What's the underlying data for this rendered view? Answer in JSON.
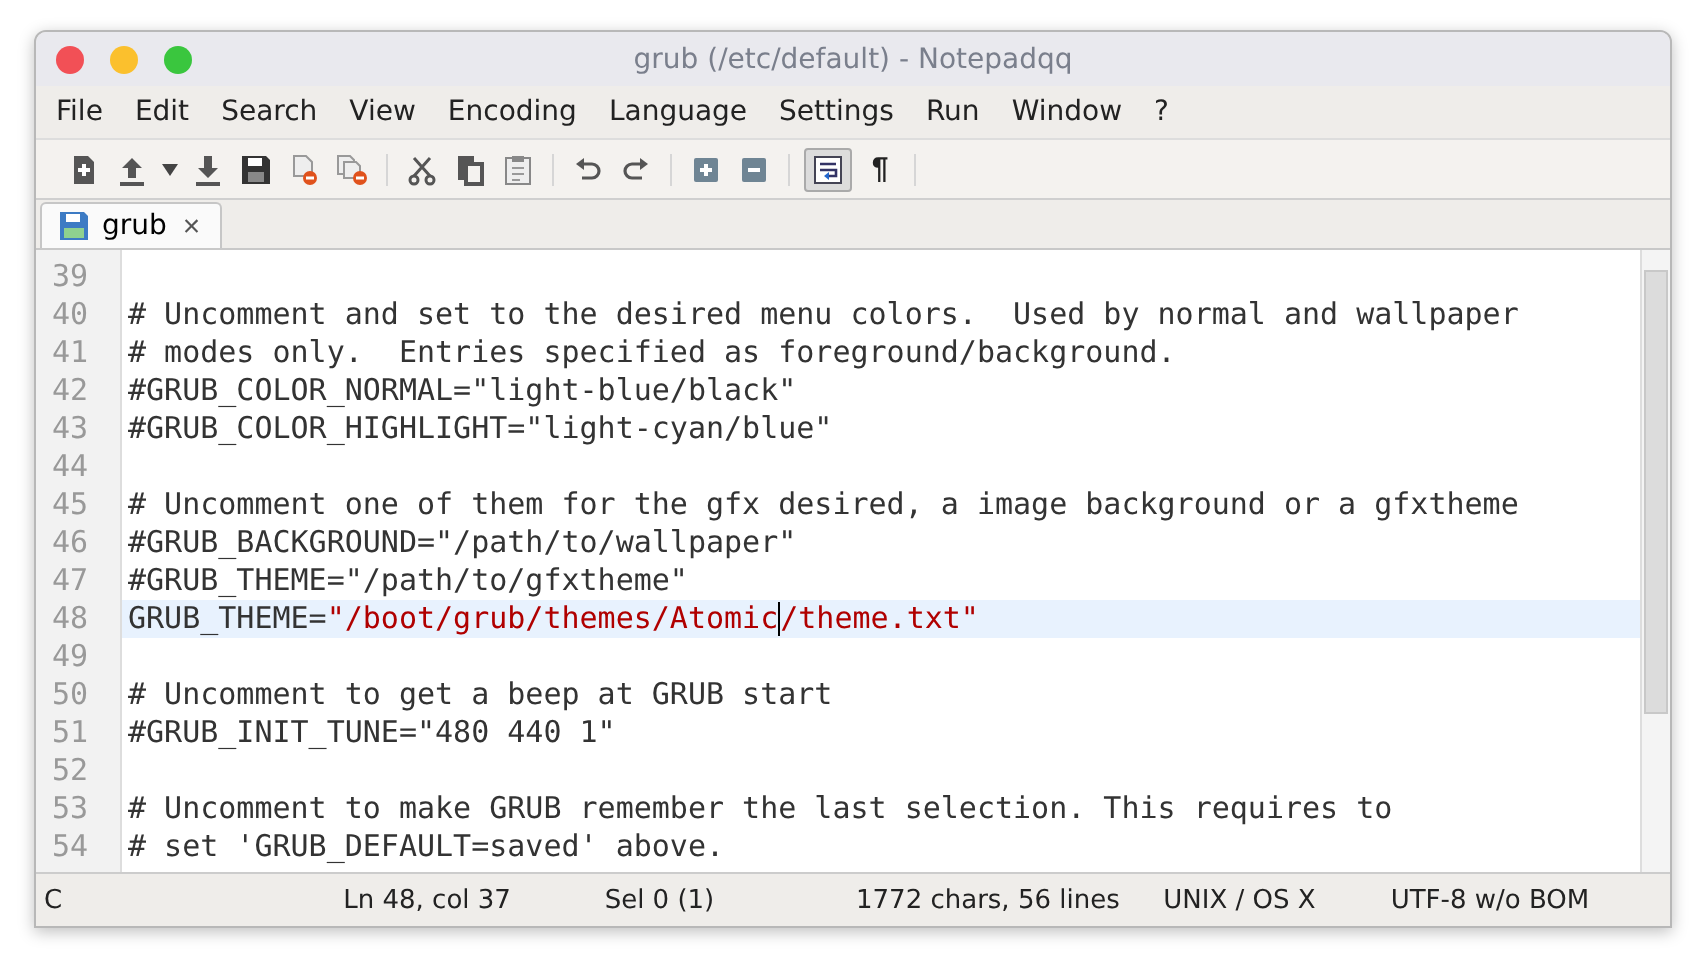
{
  "window": {
    "title": "grub (/etc/default) - Notepadqq"
  },
  "menu": [
    "File",
    "Edit",
    "Search",
    "View",
    "Encoding",
    "Language",
    "Settings",
    "Run",
    "Window",
    "?"
  ],
  "toolbar": [
    {
      "kind": "new"
    },
    {
      "kind": "open"
    },
    {
      "kind": "dropdown"
    },
    {
      "kind": "save"
    },
    {
      "kind": "save-all"
    },
    {
      "kind": "close"
    },
    {
      "kind": "close-all"
    },
    {
      "kind": "sep"
    },
    {
      "kind": "cut"
    },
    {
      "kind": "copy"
    },
    {
      "kind": "paste"
    },
    {
      "kind": "sep"
    },
    {
      "kind": "undo"
    },
    {
      "kind": "redo"
    },
    {
      "kind": "sep"
    },
    {
      "kind": "zoom-in"
    },
    {
      "kind": "zoom-out"
    },
    {
      "kind": "sep"
    },
    {
      "kind": "wrap",
      "pressed": true
    },
    {
      "kind": "glyph",
      "text": "¶"
    },
    {
      "kind": "sep"
    }
  ],
  "tabs": [
    {
      "label": "grub",
      "selected": true,
      "close": "×"
    }
  ],
  "editor": {
    "lines": [
      {
        "number": "39",
        "current": false
      },
      {
        "number": "40",
        "current": false,
        "segments": [
          {
            "kind": "plain",
            "text": "# Uncomment and set to the desired menu colors.  Used by normal and wallpaper"
          }
        ]
      },
      {
        "number": "41",
        "current": false,
        "segments": [
          {
            "kind": "plain",
            "text": "# modes only.  Entries specified as foreground/background."
          }
        ]
      },
      {
        "number": "42",
        "current": false,
        "segments": [
          {
            "kind": "plain",
            "text": "#GRUB_COLOR_NORMAL=\"light-blue/black\""
          }
        ]
      },
      {
        "number": "43",
        "current": false,
        "segments": [
          {
            "kind": "plain",
            "text": "#GRUB_COLOR_HIGHLIGHT=\"light-cyan/blue\""
          }
        ]
      },
      {
        "number": "44",
        "current": false
      },
      {
        "number": "45",
        "current": false,
        "segments": [
          {
            "kind": "plain",
            "text": "# Uncomment one of them for the gfx desired, a image background or a gfxtheme"
          }
        ]
      },
      {
        "number": "46",
        "current": false,
        "segments": [
          {
            "kind": "plain",
            "text": "#GRUB_BACKGROUND=\"/path/to/wallpaper\""
          }
        ]
      },
      {
        "number": "47",
        "current": false,
        "segments": [
          {
            "kind": "plain",
            "text": "#GRUB_THEME=\"/path/to/gfxtheme\""
          }
        ]
      },
      {
        "number": "48",
        "current": true,
        "segments": [
          {
            "kind": "plain",
            "text": "GRUB_THEME="
          },
          {
            "kind": "string",
            "text": "\"/boot/grub/themes/Atomic",
            "caret": true
          },
          {
            "kind": "string",
            "text": "/theme.txt\""
          }
        ]
      },
      {
        "number": "49",
        "current": false
      },
      {
        "number": "50",
        "current": false,
        "segments": [
          {
            "kind": "plain",
            "text": "# Uncomment to get a beep at GRUB start"
          }
        ]
      },
      {
        "number": "51",
        "current": false,
        "segments": [
          {
            "kind": "plain",
            "text": "#GRUB_INIT_TUNE=\"480 440 1\""
          }
        ]
      },
      {
        "number": "52",
        "current": false
      },
      {
        "number": "53",
        "current": false,
        "segments": [
          {
            "kind": "plain",
            "text": "# Uncomment to make GRUB remember the last selection. This requires to"
          }
        ]
      },
      {
        "number": "54",
        "current": false,
        "segments": [
          {
            "kind": "plain",
            "text": "# set 'GRUB_DEFAULT=saved' above."
          }
        ]
      }
    ]
  },
  "status_bar": [
    "C",
    "Ln 48, col 37",
    "Sel 0 (1)",
    "1772 chars, 56 lines",
    "UNIX / OS X",
    "UTF-8 w/o BOM"
  ]
}
